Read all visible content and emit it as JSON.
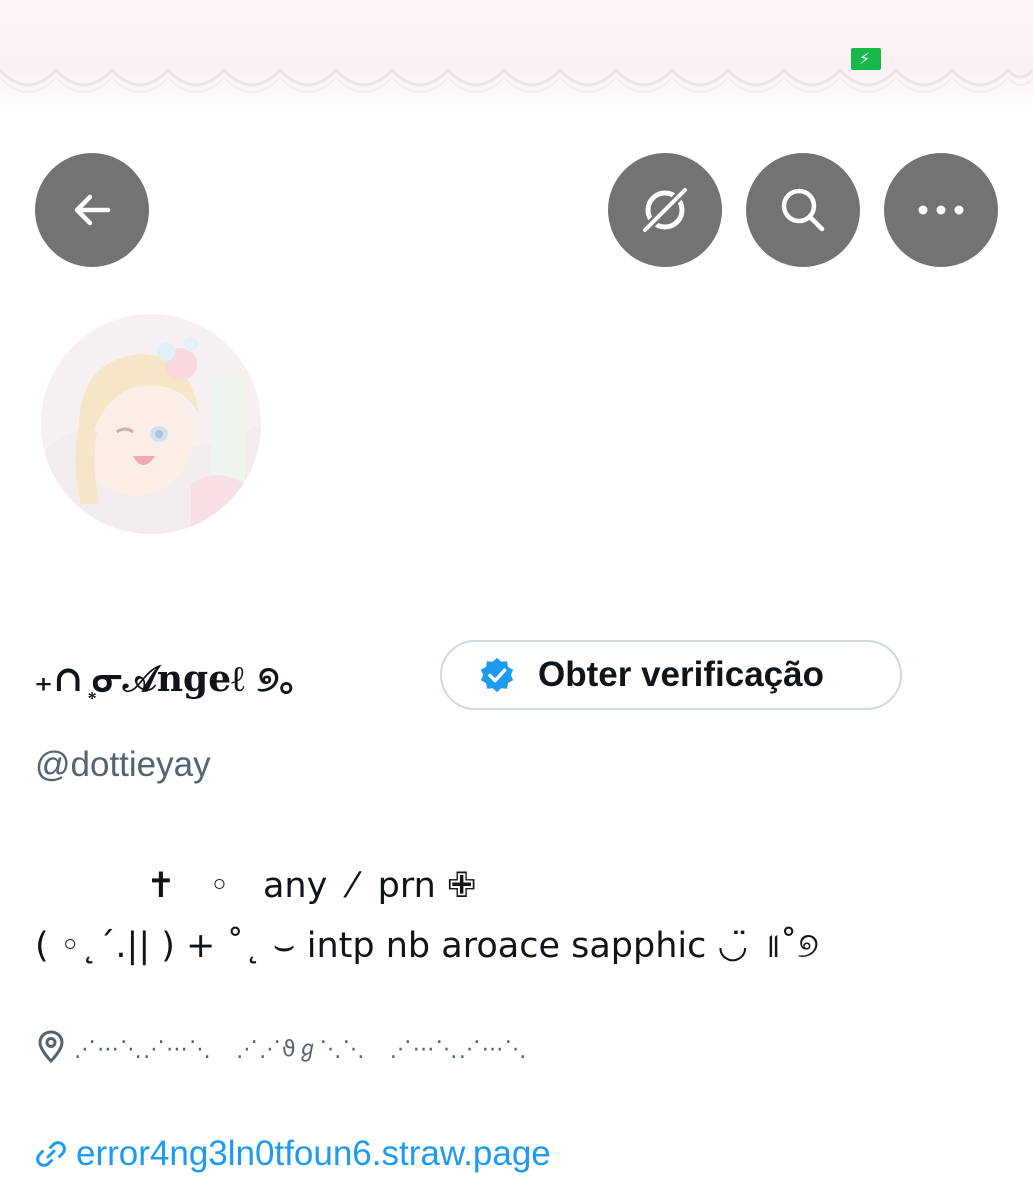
{
  "status_bar": {
    "battery_icon": "battery-charging-icon",
    "battery_color": "#18b84a"
  },
  "header": {
    "back_icon": "arrow-left-icon",
    "grok_icon": "grok-icon",
    "search_icon": "search-icon",
    "more_icon": "more-horizontal-icon",
    "button_color": "#737373"
  },
  "profile": {
    "display_name": "₊∩ ͙ᓂ𝒜ngeℓ ୭。",
    "verify_button_label": "Obter verificação",
    "verify_badge_icon": "verified-badge-icon",
    "handle": "@dottieyay",
    "bio": {
      "line1": "          ✝   ◦   any  ⁄  prn ✙",
      "line2": "( ◦˛ˊ.|| ) + ˚˛ ⌣ intp nb aroace sapphic ◡̈ ॥˚୭"
    },
    "location": {
      "icon": "location-pin-icon",
      "text": "⋰⋯⋱⋰⋯⋱   ⋰⋰ϑℊ⋱⋱   ⋰⋯⋱⋰⋯⋱"
    },
    "link": {
      "icon": "link-icon",
      "text": "error4ng3ln0tfoun6.straw.page"
    }
  },
  "colors": {
    "primary_text": "#0f1419",
    "secondary_text": "#536471",
    "link": "#1d9bf0",
    "verified_badge": "#1d9bf0"
  }
}
